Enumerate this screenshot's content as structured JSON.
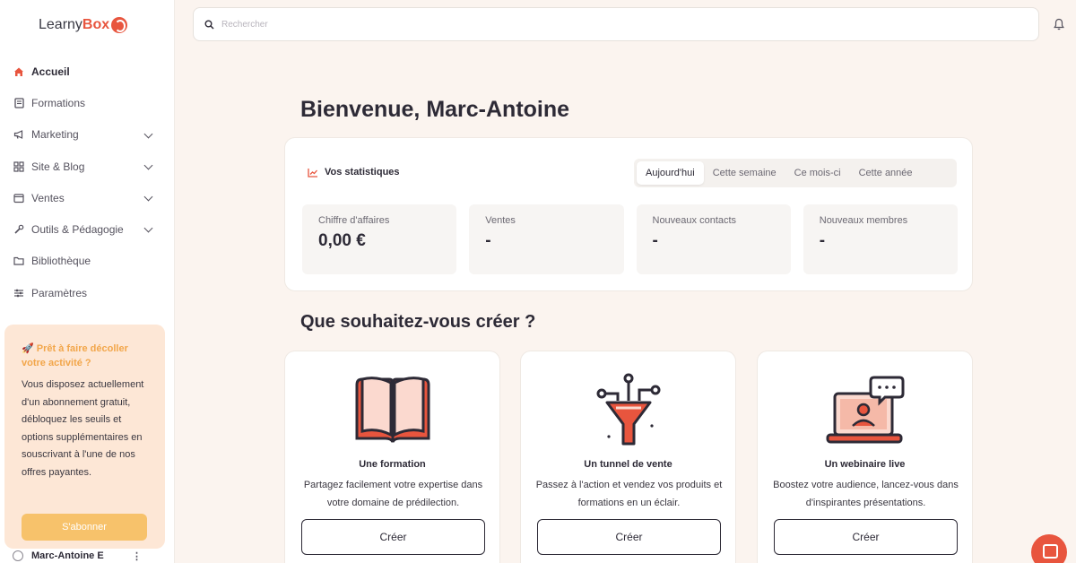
{
  "brand": {
    "name_part1": "Learny",
    "name_part2": "Box",
    "accent": "#e8553e"
  },
  "search": {
    "placeholder": "Rechercher"
  },
  "sidebar": {
    "items": [
      {
        "label": "Accueil",
        "icon": "home-icon",
        "active": true
      },
      {
        "label": "Formations",
        "icon": "book-icon"
      },
      {
        "label": "Marketing",
        "icon": "megaphone-icon",
        "expandable": true
      },
      {
        "label": "Site & Blog",
        "icon": "grid-icon",
        "expandable": true
      },
      {
        "label": "Ventes",
        "icon": "cart-icon",
        "expandable": true
      },
      {
        "label": "Outils & Pédagogie",
        "icon": "tools-icon",
        "expandable": true
      },
      {
        "label": "Bibliothèque",
        "icon": "folder-icon"
      },
      {
        "label": "Paramètres",
        "icon": "sliders-icon"
      }
    ],
    "promo": {
      "title": "🚀 Prêt à faire décoller votre activité ?",
      "text": "Vous disposez actuellement d'un abonnement gratuit, débloquez les seuils et options supplémentaires en souscrivant à l'une de nos offres payantes.",
      "button": "S'abonner"
    },
    "user": {
      "name": "Marc-Antoine E",
      "menu": "⋮"
    }
  },
  "main": {
    "welcome": "Bienvenue, Marc-Antoine",
    "stats": {
      "title": "Vos statistiques",
      "periods": [
        "Aujourd'hui",
        "Cette semaine",
        "Ce mois-ci",
        "Cette année"
      ],
      "active_period": "Aujourd'hui",
      "tiles": [
        {
          "label": "Chiffre d'affaires",
          "value": "0,00 €"
        },
        {
          "label": "Ventes",
          "value": "-"
        },
        {
          "label": "Nouveaux contacts",
          "value": "-"
        },
        {
          "label": "Nouveaux membres",
          "value": "-"
        }
      ]
    },
    "create": {
      "title": "Que souhaitez-vous créer ?",
      "cards": [
        {
          "title": "Une formation",
          "description": "Partagez facilement votre expertise dans votre domaine de prédilection.",
          "button": "Créer",
          "icon": "open-book-icon"
        },
        {
          "title": "Un tunnel de vente",
          "description": "Passez à l'action et vendez vos produits et formations en un éclair.",
          "button": "Créer",
          "icon": "funnel-icon"
        },
        {
          "title": "Un webinaire live",
          "description": "Boostez votre audience, lancez-vous dans d'inspirantes présentations.",
          "button": "Créer",
          "icon": "webinar-laptop-icon"
        }
      ]
    }
  }
}
